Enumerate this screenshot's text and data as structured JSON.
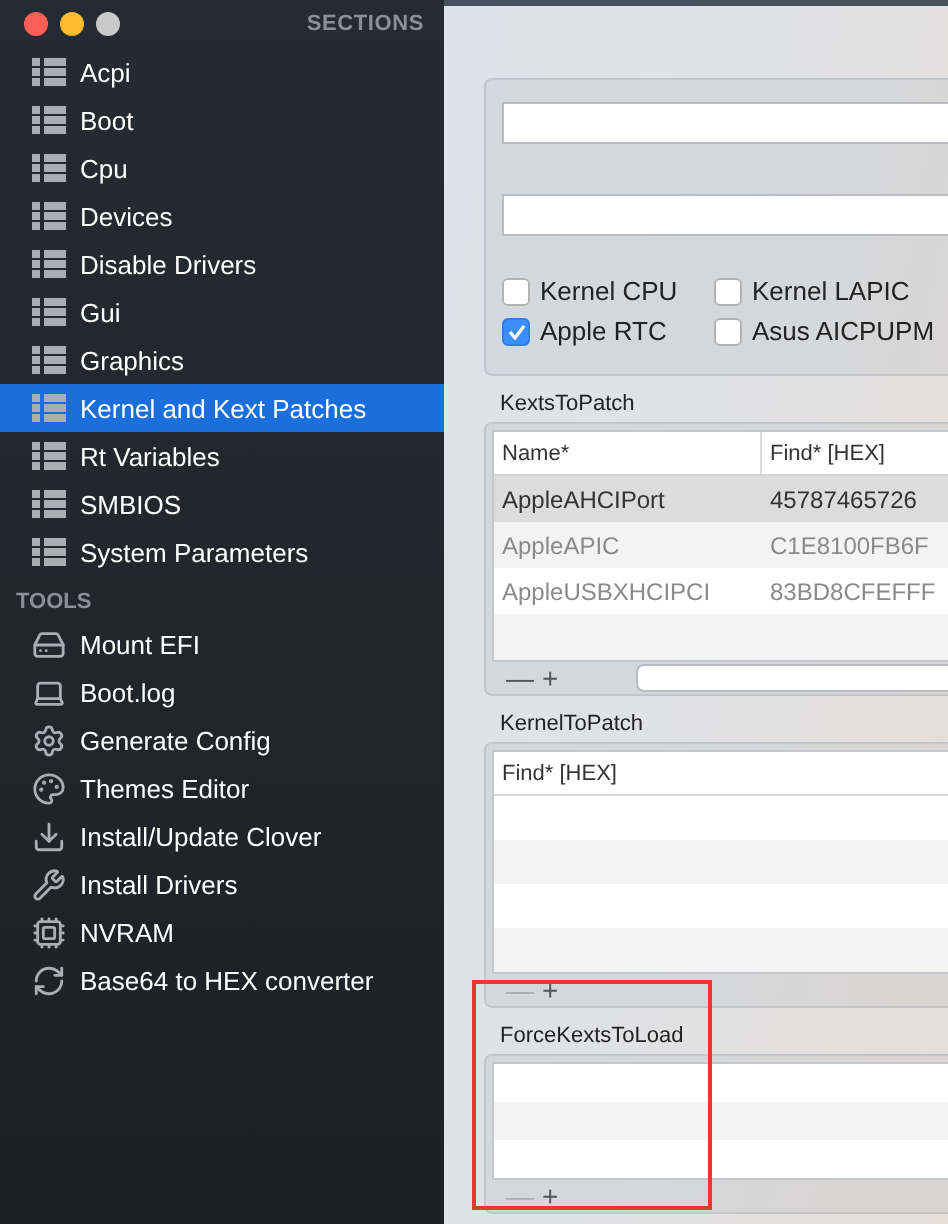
{
  "sidebar": {
    "sections_title": "SECTIONS",
    "sections": [
      {
        "label": "Acpi",
        "selected": false
      },
      {
        "label": "Boot",
        "selected": false
      },
      {
        "label": "Cpu",
        "selected": false
      },
      {
        "label": "Devices",
        "selected": false
      },
      {
        "label": "Disable Drivers",
        "selected": false
      },
      {
        "label": "Gui",
        "selected": false
      },
      {
        "label": "Graphics",
        "selected": false
      },
      {
        "label": "Kernel and Kext Patches",
        "selected": true
      },
      {
        "label": "Rt Variables",
        "selected": false
      },
      {
        "label": "SMBIOS",
        "selected": false
      },
      {
        "label": "System Parameters",
        "selected": false
      }
    ],
    "tools_title": "TOOLS",
    "tools": [
      {
        "label": "Mount EFI",
        "kind": "disk"
      },
      {
        "label": "Boot.log",
        "kind": "laptop"
      },
      {
        "label": "Generate Config",
        "kind": "gear"
      },
      {
        "label": "Themes Editor",
        "kind": "palette"
      },
      {
        "label": "Install/Update Clover",
        "kind": "download"
      },
      {
        "label": "Install Drivers",
        "kind": "tools"
      },
      {
        "label": "NVRAM",
        "kind": "chip"
      },
      {
        "label": "Base64 to HEX converter",
        "kind": "refresh"
      }
    ]
  },
  "options": {
    "checkboxes": [
      {
        "label": "Kernel CPU",
        "checked": false
      },
      {
        "label": "Kernel LAPIC",
        "checked": false
      },
      {
        "label": "Apple RTC",
        "checked": true
      },
      {
        "label": "Asus AICPUPM",
        "checked": false
      }
    ]
  },
  "tables": [
    {
      "title": "KextsToPatch",
      "columns": [
        "Name*",
        "Find* [HEX]"
      ],
      "rows": [
        {
          "cells": [
            "AppleAHCIPort",
            "45787465726"
          ],
          "selected": true,
          "disabled": false
        },
        {
          "cells": [
            "AppleAPIC",
            "C1E8100FB6F"
          ],
          "selected": false,
          "disabled": true
        },
        {
          "cells": [
            "AppleUSBXHCIPCI",
            "83BD8CFEFFF"
          ],
          "selected": false,
          "disabled": true
        }
      ],
      "remove": "—",
      "add": "+",
      "remove_disabled": false,
      "search": true,
      "highlighted": false
    },
    {
      "title": "KernelToPatch",
      "columns": [
        "Find* [HEX]"
      ],
      "remove": "—",
      "add": "+",
      "remove_disabled": true,
      "search": false,
      "highlighted": false
    },
    {
      "title": "ForceKextsToLoad",
      "remove": "—",
      "add": "+",
      "remove_disabled": true,
      "search": false,
      "highlighted": true
    }
  ]
}
